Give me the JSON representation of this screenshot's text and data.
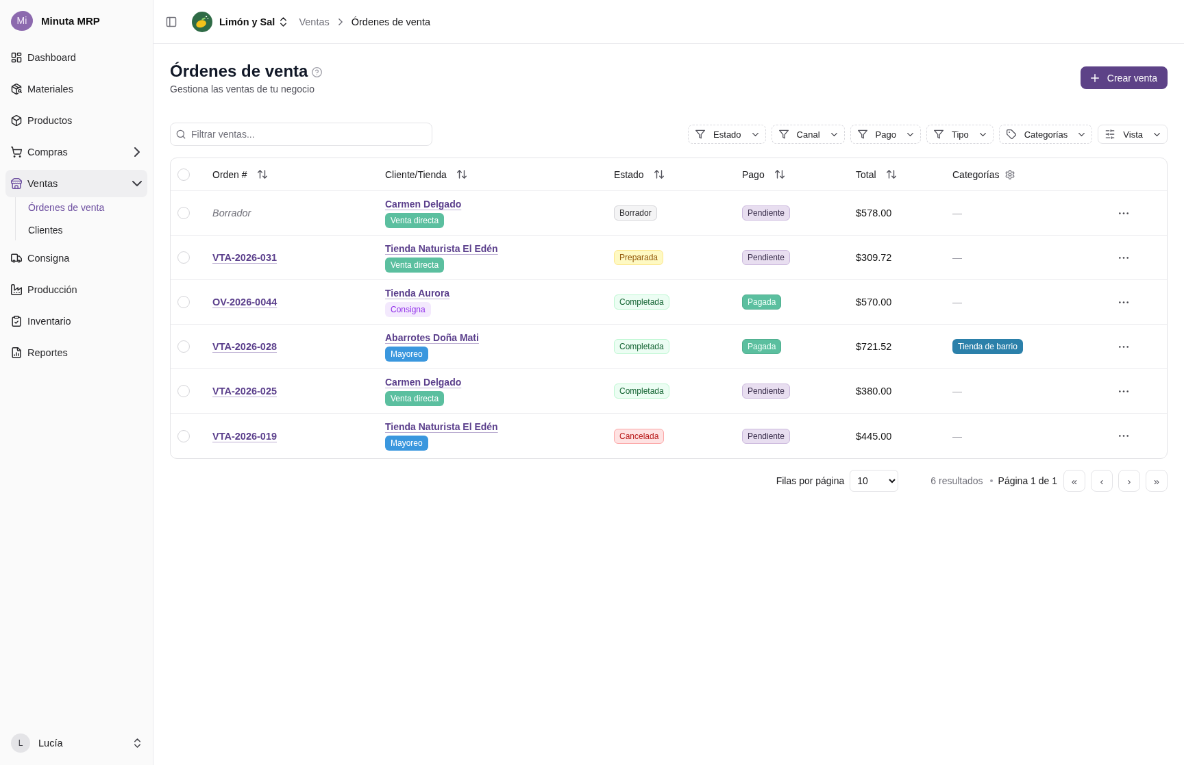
{
  "sidebar": {
    "logo_text": "Mi",
    "app_name": "Minuta MRP",
    "items": [
      {
        "label": "Dashboard",
        "kind": "link",
        "selected": false
      },
      {
        "label": "Materiales",
        "kind": "link",
        "selected": false
      },
      {
        "label": "Productos",
        "kind": "link",
        "selected": false
      },
      {
        "label": "Compras",
        "kind": "group",
        "selected": false,
        "expanded": false
      },
      {
        "label": "Ventas",
        "kind": "group",
        "selected": true,
        "expanded": true,
        "children": [
          {
            "label": "Órdenes de venta",
            "selected": true
          },
          {
            "label": "Clientes",
            "selected": false
          }
        ]
      },
      {
        "label": "Consigna",
        "kind": "link",
        "selected": false
      },
      {
        "label": "Producción",
        "kind": "link",
        "selected": false
      },
      {
        "label": "Inventario",
        "kind": "link",
        "selected": false
      },
      {
        "label": "Reportes",
        "kind": "link",
        "selected": false
      }
    ],
    "user": {
      "initial": "L",
      "name": "Lucía"
    }
  },
  "header": {
    "workspace": "Limón y Sal",
    "breadcrumbs": [
      {
        "label": "Ventas",
        "current": false
      },
      {
        "label": "Órdenes de venta",
        "current": true
      }
    ]
  },
  "page": {
    "title": "Órdenes de venta",
    "subtitle": "Gestiona las ventas de tu negocio",
    "primary_action": "Crear venta"
  },
  "toolbar": {
    "search": {
      "placeholder": "Filtrar ventas..."
    },
    "filters": [
      {
        "label": "Estado",
        "kind": "filter"
      },
      {
        "label": "Canal",
        "kind": "filter"
      },
      {
        "label": "Pago",
        "kind": "filter"
      },
      {
        "label": "Tipo",
        "kind": "filter"
      },
      {
        "label": "Categorías",
        "kind": "tag"
      },
      {
        "label": "Vista",
        "kind": "view"
      }
    ]
  },
  "table": {
    "select_all": {
      "checked": false
    },
    "columns": [
      {
        "label": "Orden #",
        "kind": "sort"
      },
      {
        "label": "Cliente/Tienda",
        "kind": "sort"
      },
      {
        "label": "Estado",
        "kind": "sort"
      },
      {
        "label": "Pago",
        "kind": "sort"
      },
      {
        "label": "Total",
        "kind": "sort"
      },
      {
        "label": "Categorías",
        "kind": "settings"
      }
    ],
    "rows": [
      {
        "selected": false,
        "order": {
          "text": "Borrador",
          "kind": "draft"
        },
        "client": "Carmen Delgado",
        "channel": {
          "label": "Venta directa",
          "kind": "direct",
          "color": "#5bbf9f"
        },
        "status": {
          "label": "Borrador",
          "kind": "draft"
        },
        "payment": {
          "label": "Pendiente",
          "kind": "pending"
        },
        "total": "$578.00",
        "category": {
          "label": "—",
          "kind": "empty"
        }
      },
      {
        "selected": false,
        "order": {
          "text": "VTA-2026-031",
          "kind": "link"
        },
        "client": "Tienda Naturista El Edén",
        "channel": {
          "label": "Venta directa",
          "kind": "direct",
          "color": "#5bbf9f"
        },
        "status": {
          "label": "Preparada",
          "kind": "prepared"
        },
        "payment": {
          "label": "Pendiente",
          "kind": "pending"
        },
        "total": "$309.72",
        "category": {
          "label": "—",
          "kind": "empty"
        }
      },
      {
        "selected": false,
        "order": {
          "text": "OV-2026-0044",
          "kind": "link"
        },
        "client": "Tienda Aurora",
        "channel": {
          "label": "Consigna",
          "kind": "consignment",
          "color": "#9333ea"
        },
        "status": {
          "label": "Completada",
          "kind": "completed"
        },
        "payment": {
          "label": "Pagada",
          "kind": "paid"
        },
        "total": "$570.00",
        "category": {
          "label": "—",
          "kind": "empty"
        }
      },
      {
        "selected": false,
        "order": {
          "text": "VTA-2026-028",
          "kind": "link"
        },
        "client": "Abarrotes Doña Mati",
        "channel": {
          "label": "Mayoreo",
          "kind": "wholesale",
          "color": "#3a97de"
        },
        "status": {
          "label": "Completada",
          "kind": "completed"
        },
        "payment": {
          "label": "Pagada",
          "kind": "paid"
        },
        "total": "$721.52",
        "category": {
          "label": "Tienda de barrio",
          "kind": "tag",
          "color": "#2b80aa"
        }
      },
      {
        "selected": false,
        "order": {
          "text": "VTA-2026-025",
          "kind": "link"
        },
        "client": "Carmen Delgado",
        "channel": {
          "label": "Venta directa",
          "kind": "direct",
          "color": "#5bbf9f"
        },
        "status": {
          "label": "Completada",
          "kind": "completed"
        },
        "payment": {
          "label": "Pendiente",
          "kind": "pending"
        },
        "total": "$380.00",
        "category": {
          "label": "—",
          "kind": "empty"
        }
      },
      {
        "selected": false,
        "order": {
          "text": "VTA-2026-019",
          "kind": "link"
        },
        "client": "Tienda Naturista El Edén",
        "channel": {
          "label": "Mayoreo",
          "kind": "wholesale",
          "color": "#3a97de"
        },
        "status": {
          "label": "Cancelada",
          "kind": "cancelled"
        },
        "payment": {
          "label": "Pendiente",
          "kind": "pending"
        },
        "total": "$445.00",
        "category": {
          "label": "—",
          "kind": "empty"
        }
      }
    ]
  },
  "pagination": {
    "rows_label": "Filas por página",
    "page_size": "10",
    "results": "6 resultados",
    "page_label": "Página 1 de 1",
    "nav_buttons": [
      "«",
      "‹",
      "›",
      "»"
    ]
  }
}
